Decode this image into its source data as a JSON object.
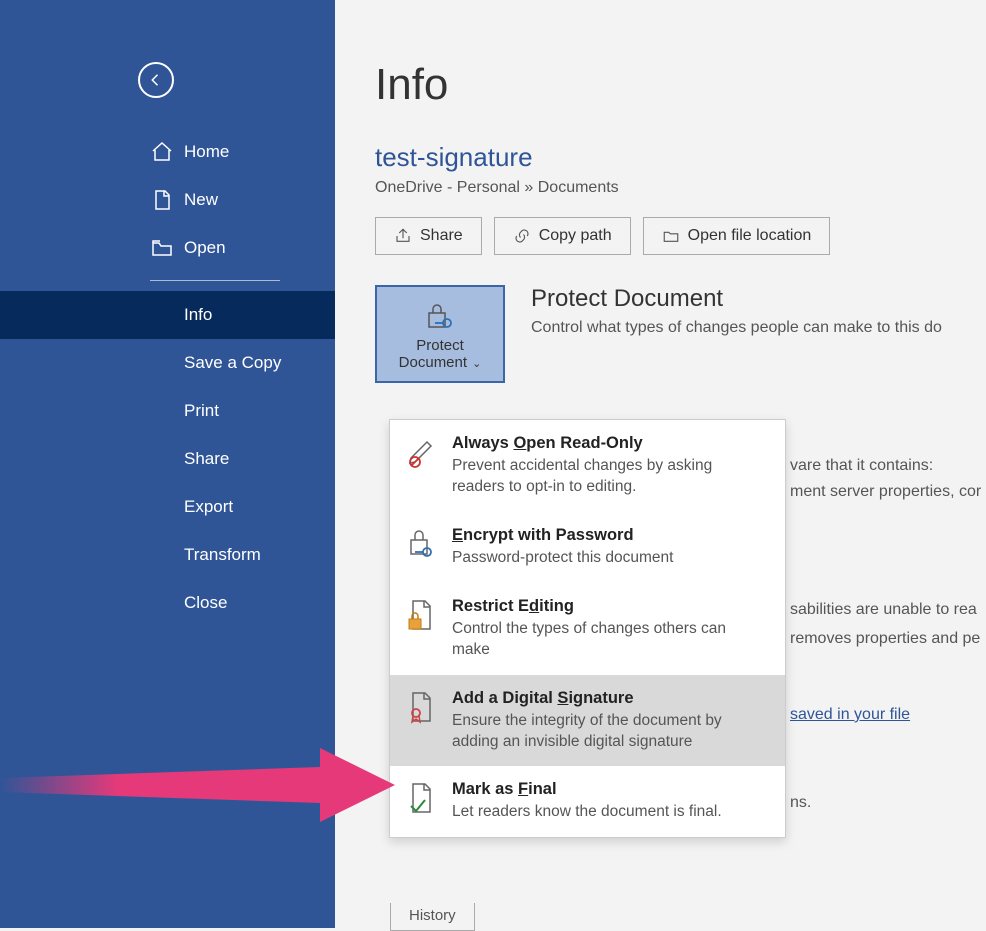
{
  "sidebar": {
    "items": [
      {
        "label": "Home"
      },
      {
        "label": "New"
      },
      {
        "label": "Open"
      },
      {
        "label": "Info"
      },
      {
        "label": "Save a Copy"
      },
      {
        "label": "Print"
      },
      {
        "label": "Share"
      },
      {
        "label": "Export"
      },
      {
        "label": "Transform"
      },
      {
        "label": "Close"
      }
    ]
  },
  "main": {
    "title": "Info",
    "doc_name": "test-signature",
    "breadcrumb": "OneDrive - Personal » Documents",
    "actions": {
      "share": "Share",
      "copy_path": "Copy path",
      "open_location": "Open file location"
    },
    "protect": {
      "button_line1": "Protect",
      "button_line2": "Document",
      "heading": "Protect Document",
      "desc": "Control what types of changes people can make to this do"
    },
    "bg": {
      "line1": "vare that it contains:",
      "line2": "ment server properties, cor",
      "line3": "sabilities are unable to rea",
      "line4": "removes properties and pe",
      "link": "saved in your file",
      "line5": "ns."
    },
    "history_tab": "History"
  },
  "dropdown": {
    "items": [
      {
        "title": "Always Open Read-Only",
        "desc": "Prevent accidental changes by asking readers to opt-in to editing."
      },
      {
        "title": "Encrypt with Password",
        "desc": "Password-protect this document"
      },
      {
        "title": "Restrict Editing",
        "desc": "Control the types of changes others can make"
      },
      {
        "title": "Add a Digital Signature",
        "desc": "Ensure the integrity of the document by adding an invisible digital signature"
      },
      {
        "title": "Mark as Final",
        "desc": "Let readers know the document is final."
      }
    ]
  }
}
